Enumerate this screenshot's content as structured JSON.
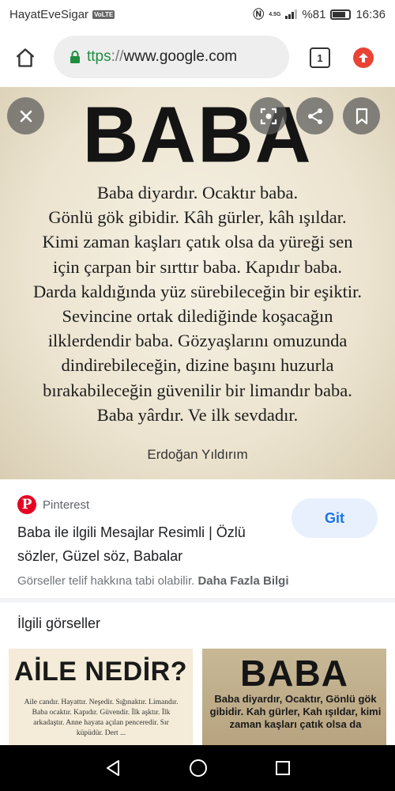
{
  "status_bar": {
    "carrier": "HayatEveSigar",
    "volte": "VoLTE",
    "network": "4.5G",
    "battery": "%81",
    "time": "16:36"
  },
  "browser": {
    "url_scheme": "ttps",
    "url_sep": "://",
    "url_host": "www.google.com",
    "tab_count": "1"
  },
  "image": {
    "title": "BABA",
    "lines": [
      "Baba diyardır. Ocaktır baba.",
      "Gönlü gök gibidir. Kâh gürler, kâh ışıldar.",
      "Kimi zaman kaşları çatık olsa da yüreği sen",
      "için çarpan bir sırttır baba. Kapıdır baba.",
      "Darda kaldığında yüz sürebileceğin bir eşiktir.",
      "Sevincine ortak dilediğinde koşacağın",
      "ilklerdendir baba. Gözyaşlarını omuzunda",
      "dindirebileceğin, dizine başını huzurla",
      "bırakabileceğin güvenilir bir limandır baba.",
      "Baba yârdır. Ve ilk sevdadır."
    ],
    "author": "Erdoğan Yıldırım"
  },
  "source": {
    "site": "Pinterest",
    "title": "Baba ile ilgili Mesajlar Resimli | Özlü sözler, Güzel söz, Babalar",
    "visit_label": "Git",
    "copyright_text": "Görseller telif hakkına tabi olabilir.",
    "more_info": "Daha Fazla Bilgi"
  },
  "related": {
    "heading": "İlgili görseller",
    "thumbs": [
      {
        "title": "AİLE NEDİR?",
        "text": "Aile candır. Hayattır. Neşedir. Sığınaktır. Limandır. Baba ocaktır. Kapıdır. Güvendir. İlk aşktır. İlk arkadaştır. Anne hayata açılan penceredir. Sır küpüdür. Dert ..."
      },
      {
        "title": "BABA",
        "text": "Baba diyardır, Ocaktır, Gönlü gök gibidir. Kah gürler, Kah ışıldar, kimi zaman kaşları çatık olsa da"
      }
    ]
  }
}
